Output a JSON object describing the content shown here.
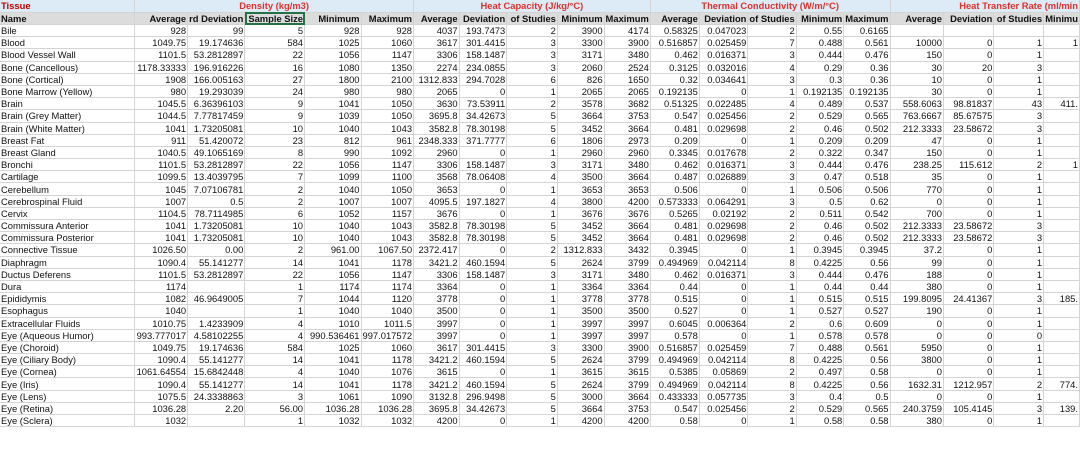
{
  "groups": {
    "tissue": "Tissue",
    "density": "Density (kg/m3)",
    "heat_capacity": "Heat Capacity (J/kg/°C)",
    "thermal_conductivity": "Thermal Conductivity (W/m/°C)",
    "heat_transfer": "Heat Transfer Rate (ml/min"
  },
  "columns": [
    "Name",
    "Average",
    "rd Deviation",
    "Sample Size",
    "Minimum",
    "Maximum",
    "Average",
    "Deviation",
    "of Studies",
    "Minimum",
    "Maximum",
    "Average",
    "Deviation",
    "of Studies",
    "Minimum",
    "Maximum",
    "Average",
    "Deviation",
    "of Studies",
    "Minimu"
  ],
  "rows": [
    [
      "Bile",
      "928",
      "99",
      "5",
      "928",
      "928",
      "4037",
      "193.7473",
      "2",
      "3900",
      "4174",
      "0.58325",
      "0.047023",
      "2",
      "0.55",
      "0.6165",
      "",
      "",
      "",
      ""
    ],
    [
      "Blood",
      "1049.75",
      "19.174636",
      "584",
      "1025",
      "1060",
      "3617",
      "301.4415",
      "3",
      "3300",
      "3900",
      "0.516857",
      "0.025459",
      "7",
      "0.488",
      "0.561",
      "10000",
      "0",
      "1",
      "1"
    ],
    [
      "Blood Vessel Wall",
      "1101.5",
      "53.2812897",
      "22",
      "1056",
      "1147",
      "3306",
      "158.1487",
      "3",
      "3171",
      "3480",
      "0.462",
      "0.016371",
      "3",
      "0.444",
      "0.476",
      "150",
      "0",
      "1",
      ""
    ],
    [
      "Bone (Cancellous)",
      "1178.33333",
      "196.916226",
      "16",
      "1080",
      "1350",
      "2274",
      "234.0855",
      "3",
      "2060",
      "2524",
      "0.3125",
      "0.032016",
      "4",
      "0.29",
      "0.36",
      "30",
      "20",
      "3",
      ""
    ],
    [
      "Bone (Cortical)",
      "1908",
      "166.005163",
      "27",
      "1800",
      "2100",
      "1312.833",
      "294.7028",
      "6",
      "826",
      "1650",
      "0.32",
      "0.034641",
      "3",
      "0.3",
      "0.36",
      "10",
      "0",
      "1",
      ""
    ],
    [
      "Bone Marrow (Yellow)",
      "980",
      "19.293039",
      "24",
      "980",
      "980",
      "2065",
      "0",
      "1",
      "2065",
      "2065",
      "0.192135",
      "0",
      "1",
      "0.192135",
      "0.192135",
      "30",
      "0",
      "1",
      ""
    ],
    [
      "Brain",
      "1045.5",
      "6.36396103",
      "9",
      "1041",
      "1050",
      "3630",
      "73.53911",
      "2",
      "3578",
      "3682",
      "0.51325",
      "0.022485",
      "4",
      "0.489",
      "0.537",
      "558.6063",
      "98.81837",
      "43",
      "411."
    ],
    [
      "Brain (Grey Matter)",
      "1044.5",
      "7.77817459",
      "9",
      "1039",
      "1050",
      "3695.8",
      "34.42673",
      "5",
      "3664",
      "3753",
      "0.547",
      "0.025456",
      "2",
      "0.529",
      "0.565",
      "763.6667",
      "85.67575",
      "3",
      ""
    ],
    [
      "Brain (White Matter)",
      "1041",
      "1.73205081",
      "10",
      "1040",
      "1043",
      "3582.8",
      "78.30198",
      "5",
      "3452",
      "3664",
      "0.481",
      "0.029698",
      "2",
      "0.46",
      "0.502",
      "212.3333",
      "23.58672",
      "3",
      ""
    ],
    [
      "Breast Fat",
      "911",
      "51.420072",
      "23",
      "812",
      "961",
      "2348.333",
      "371.7777",
      "6",
      "1806",
      "2973",
      "0.209",
      "0",
      "1",
      "0.209",
      "0.209",
      "47",
      "0",
      "1",
      ""
    ],
    [
      "Breast Gland",
      "1040.5",
      "49.1065169",
      "8",
      "990",
      "1092",
      "2960",
      "0",
      "1",
      "2960",
      "2960",
      "0.3345",
      "0.017678",
      "2",
      "0.322",
      "0.347",
      "150",
      "0",
      "1",
      ""
    ],
    [
      "Bronchi",
      "1101.5",
      "53.2812897",
      "22",
      "1056",
      "1147",
      "3306",
      "158.1487",
      "3",
      "3171",
      "3480",
      "0.462",
      "0.016371",
      "3",
      "0.444",
      "0.476",
      "238.25",
      "115.612",
      "2",
      "1"
    ],
    [
      "Cartilage",
      "1099.5",
      "13.4039795",
      "7",
      "1099",
      "1100",
      "3568",
      "78.06408",
      "4",
      "3500",
      "3664",
      "0.487",
      "0.026889",
      "3",
      "0.47",
      "0.518",
      "35",
      "0",
      "1",
      ""
    ],
    [
      "Cerebellum",
      "1045",
      "7.07106781",
      "2",
      "1040",
      "1050",
      "3653",
      "0",
      "1",
      "3653",
      "3653",
      "0.506",
      "0",
      "1",
      "0.506",
      "0.506",
      "770",
      "0",
      "1",
      ""
    ],
    [
      "Cerebrospinal Fluid",
      "1007",
      "0.5",
      "2",
      "1007",
      "1007",
      "4095.5",
      "197.1827",
      "4",
      "3800",
      "4200",
      "0.573333",
      "0.064291",
      "3",
      "0.5",
      "0.62",
      "0",
      "0",
      "1",
      ""
    ],
    [
      "Cervix",
      "1104.5",
      "78.7114985",
      "6",
      "1052",
      "1157",
      "3676",
      "0",
      "1",
      "3676",
      "3676",
      "0.5265",
      "0.02192",
      "2",
      "0.511",
      "0.542",
      "700",
      "0",
      "1",
      ""
    ],
    [
      "Commissura Anterior",
      "1041",
      "1.73205081",
      "10",
      "1040",
      "1043",
      "3582.8",
      "78.30198",
      "5",
      "3452",
      "3664",
      "0.481",
      "0.029698",
      "2",
      "0.46",
      "0.502",
      "212.3333",
      "23.58672",
      "3",
      ""
    ],
    [
      "Commissura Posterior",
      "1041",
      "1.73205081",
      "10",
      "1040",
      "1043",
      "3582.8",
      "78.30198",
      "5",
      "3452",
      "3664",
      "0.481",
      "0.029698",
      "2",
      "0.46",
      "0.502",
      "212.3333",
      "23.58672",
      "3",
      ""
    ],
    [
      "Connective Tissue",
      "1026.50",
      "0.00",
      "2",
      "961.00",
      "1067.50",
      "2372.417",
      "0",
      "2",
      "1312.833",
      "3432",
      "0.3945",
      "0",
      "1",
      "0.3945",
      "0.3945",
      "37.2",
      "0",
      "1",
      ""
    ],
    [
      "Diaphragm",
      "1090.4",
      "55.141277",
      "14",
      "1041",
      "1178",
      "3421.2",
      "460.1594",
      "5",
      "2624",
      "3799",
      "0.494969",
      "0.042114",
      "8",
      "0.4225",
      "0.56",
      "99",
      "0",
      "1",
      ""
    ],
    [
      "Ductus Deferens",
      "1101.5",
      "53.2812897",
      "22",
      "1056",
      "1147",
      "3306",
      "158.1487",
      "3",
      "3171",
      "3480",
      "0.462",
      "0.016371",
      "3",
      "0.444",
      "0.476",
      "188",
      "0",
      "1",
      ""
    ],
    [
      "Dura",
      "1174",
      "",
      "1",
      "1174",
      "1174",
      "3364",
      "0",
      "1",
      "3364",
      "3364",
      "0.44",
      "0",
      "1",
      "0.44",
      "0.44",
      "380",
      "0",
      "1",
      ""
    ],
    [
      "Epididymis",
      "1082",
      "46.9649005",
      "7",
      "1044",
      "1120",
      "3778",
      "0",
      "1",
      "3778",
      "3778",
      "0.515",
      "0",
      "1",
      "0.515",
      "0.515",
      "199.8095",
      "24.41367",
      "3",
      "185."
    ],
    [
      "Esophagus",
      "1040",
      "",
      "1",
      "1040",
      "1040",
      "3500",
      "0",
      "1",
      "3500",
      "3500",
      "0.527",
      "0",
      "1",
      "0.527",
      "0.527",
      "190",
      "0",
      "1",
      ""
    ],
    [
      "Extracellular Fluids",
      "1010.75",
      "1.4233909",
      "4",
      "1010",
      "1011.5",
      "3997",
      "0",
      "1",
      "3997",
      "3997",
      "0.6045",
      "0.006364",
      "2",
      "0.6",
      "0.609",
      "0",
      "0",
      "1",
      ""
    ],
    [
      "Eye (Aqueous Humor)",
      "993.777017",
      "4.58102255",
      "4",
      "990.536461",
      "997.017572",
      "3997",
      "0",
      "1",
      "3997",
      "3997",
      "0.578",
      "0",
      "1",
      "0.578",
      "0.578",
      "0",
      "0",
      "0",
      ""
    ],
    [
      "Eye (Choroid)",
      "1049.75",
      "19.174636",
      "584",
      "1025",
      "1060",
      "3617",
      "301.4415",
      "3",
      "3300",
      "3900",
      "0.516857",
      "0.025459",
      "7",
      "0.488",
      "0.561",
      "5950",
      "0",
      "1",
      ""
    ],
    [
      "Eye (Ciliary Body)",
      "1090.4",
      "55.141277",
      "14",
      "1041",
      "1178",
      "3421.2",
      "460.1594",
      "5",
      "2624",
      "3799",
      "0.494969",
      "0.042114",
      "8",
      "0.4225",
      "0.56",
      "3800",
      "0",
      "1",
      ""
    ],
    [
      "Eye (Cornea)",
      "1061.64554",
      "15.6842448",
      "4",
      "1040",
      "1076",
      "3615",
      "0",
      "1",
      "3615",
      "3615",
      "0.5385",
      "0.05869",
      "2",
      "0.497",
      "0.58",
      "0",
      "0",
      "1",
      ""
    ],
    [
      "Eye (Iris)",
      "1090.4",
      "55.141277",
      "14",
      "1041",
      "1178",
      "3421.2",
      "460.1594",
      "5",
      "2624",
      "3799",
      "0.494969",
      "0.042114",
      "8",
      "0.4225",
      "0.56",
      "1632.31",
      "1212.957",
      "2",
      "774."
    ],
    [
      "Eye (Lens)",
      "1075.5",
      "24.3338863",
      "3",
      "1061",
      "1090",
      "3132.8",
      "296.9498",
      "5",
      "3000",
      "3664",
      "0.433333",
      "0.057735",
      "3",
      "0.4",
      "0.5",
      "0",
      "0",
      "1",
      ""
    ],
    [
      "Eye (Retina)",
      "1036.28",
      "2.20",
      "56.00",
      "1036.28",
      "1036.28",
      "3695.8",
      "34.42673",
      "5",
      "3664",
      "3753",
      "0.547",
      "0.025456",
      "2",
      "0.529",
      "0.565",
      "240.3759",
      "105.4145",
      "3",
      "139."
    ],
    [
      "Eye (Sclera)",
      "1032",
      "",
      "1",
      "1032",
      "1032",
      "4200",
      "0",
      "1",
      "4200",
      "4200",
      "0.58",
      "0",
      "1",
      "0.58",
      "0.58",
      "380",
      "0",
      "1",
      ""
    ]
  ]
}
